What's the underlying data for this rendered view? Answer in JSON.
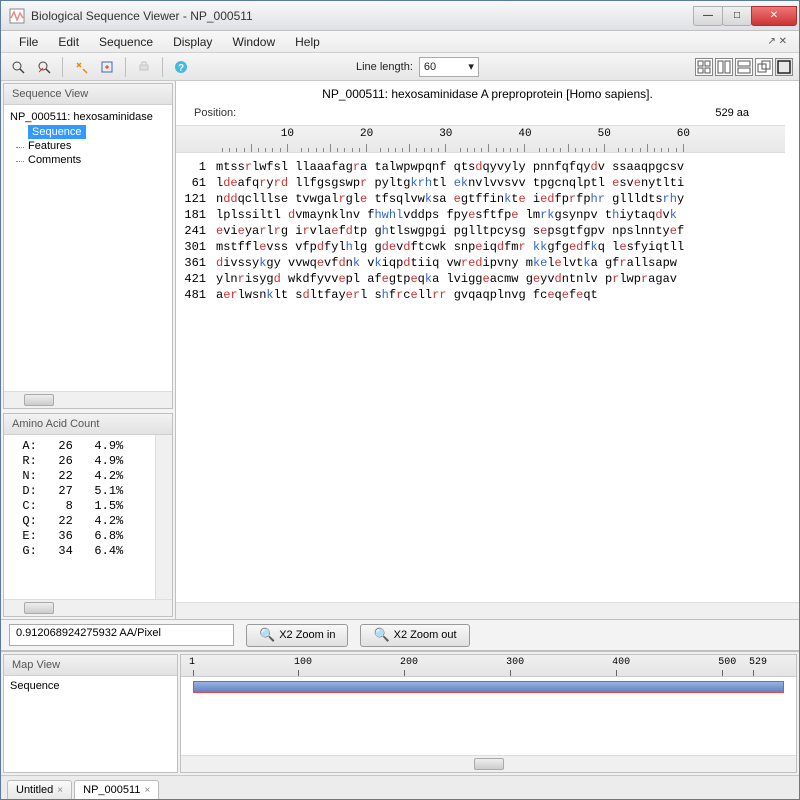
{
  "window": {
    "title": "Biological Sequence Viewer - NP_000511"
  },
  "menu": {
    "file": "File",
    "edit": "Edit",
    "sequence": "Sequence",
    "display": "Display",
    "window": "Window",
    "help": "Help"
  },
  "toolbar": {
    "line_length_label": "Line length:",
    "line_length_value": "60"
  },
  "sequence_view": {
    "panel_title": "Sequence View",
    "root": "NP_000511: hexosaminidase",
    "items": [
      "Sequence",
      "Features",
      "Comments"
    ],
    "selected_index": 0
  },
  "amino_acid_count": {
    "panel_title": "Amino Acid Count",
    "rows": [
      {
        "aa": "A:",
        "count": "26",
        "pct": "4.9%"
      },
      {
        "aa": "R:",
        "count": "26",
        "pct": "4.9%"
      },
      {
        "aa": "N:",
        "count": "22",
        "pct": "4.2%"
      },
      {
        "aa": "D:",
        "count": "27",
        "pct": "5.1%"
      },
      {
        "aa": "C:",
        "count": "8",
        "pct": "1.5%"
      },
      {
        "aa": "Q:",
        "count": "22",
        "pct": "4.2%"
      },
      {
        "aa": "E:",
        "count": "36",
        "pct": "6.8%"
      },
      {
        "aa": "G:",
        "count": "34",
        "pct": "6.4%"
      }
    ]
  },
  "sequence_panel": {
    "title": "NP_000511: hexosaminidase A preproprotein [Homo sapiens].",
    "position_label": "Position:",
    "position_value": "529 aa",
    "ruler_marks": [
      10,
      20,
      30,
      40,
      50,
      60
    ]
  },
  "sequence_lines": [
    {
      "n": "1",
      "blocks": [
        "mtss",
        "r",
        "lwfsl llaaafag",
        "r",
        "a talwpwpqnf qts",
        "d",
        "qyvyly pnnfqfqy",
        "d",
        "v ssaaqpgcsv"
      ]
    },
    {
      "n": "61",
      "blocks": [
        "l",
        "de",
        "afq",
        "r",
        "y",
        "rd",
        " llfgsgswp",
        "r",
        " pyltg",
        "krh",
        "tl ",
        "ek",
        "nvlvvsvv tpgcnqlptl ",
        "e",
        "sv",
        "e",
        "nytlti"
      ]
    },
    {
      "n": "121",
      "blocks": [
        "n",
        "dd",
        "qclllse tvwgal",
        "r",
        "gl",
        "e",
        " tfsqlvw",
        "k",
        "sa ",
        "e",
        "gtffin",
        "k",
        "t",
        "e",
        " i",
        "ed",
        "fp",
        "r",
        "fp",
        "hr",
        " gllldts",
        "rh",
        "y"
      ]
    },
    {
      "n": "181",
      "blocks": [
        "lplssiltl ",
        "d",
        "vmaynkl",
        "nv f",
        "hw",
        "hl",
        "vdd",
        "ps fpy",
        "e",
        "sftfp",
        "e",
        " lm",
        "rk",
        "gsynpv t",
        "h",
        "iytaq",
        "d",
        "v",
        "k"
      ]
    },
    {
      "n": "241",
      "blocks": [
        "e",
        "vi",
        "e",
        "ya",
        "r",
        "l",
        "r",
        "g i",
        "r",
        "vla",
        "e",
        "f",
        "d",
        "tp g",
        "h",
        "tlswgpgi pglltpcysg s",
        "e",
        "psgtfgpv npslnnty",
        "e",
        "f"
      ]
    },
    {
      "n": "301",
      "blocks": [
        "mstffl",
        "e",
        "vss vfp",
        "d",
        "fyl",
        "h",
        "lg g",
        "de",
        "v",
        "d",
        "ftcwk snp",
        "e",
        "iq",
        "d",
        "fm",
        "r",
        " ",
        "kk",
        "gfg",
        "ed",
        "f",
        "k",
        "q l",
        "e",
        "sfyiqtll"
      ]
    },
    {
      "n": "361",
      "blocks": [
        "d",
        "ivssy",
        "k",
        "gy vvwq",
        "e",
        "vf",
        "d",
        "n",
        "k",
        " v",
        "k",
        "iqp",
        "d",
        "tiiq vw",
        "red",
        "ipvny m",
        "ke",
        "l",
        "e",
        "lvt",
        "k",
        "a gf",
        "r",
        "allsapw"
      ]
    },
    {
      "n": "421",
      "blocks": [
        "yln",
        "r",
        "isyg",
        "d",
        " w",
        "kd",
        "fyvv",
        "e",
        "pl af",
        "e",
        "gtp",
        "e",
        "q",
        "k",
        "a lvigg",
        "e",
        "acmw g",
        "e",
        "yv",
        "d",
        "ntnlv p",
        "r",
        "lwp",
        "r",
        "agav"
      ]
    },
    {
      "n": "481",
      "blocks": [
        "a",
        "er",
        "lwsn",
        "k",
        "lt s",
        "d",
        "ltfay",
        "er",
        "l s",
        "h",
        "f",
        "r",
        "c",
        "e",
        "ll",
        "rr",
        " gvqaqplnvg fc",
        "e",
        "q",
        "e",
        "f",
        "e",
        "qt"
      ]
    }
  ],
  "color_map": {
    "r": "r",
    "d": "r",
    "e": "r",
    "k": "b",
    "h": "b",
    "de": "r",
    "rd": "r",
    "er": "r",
    "ed": "r",
    "red": "r",
    "rr": "r",
    "dd": "r",
    "krh": "b",
    "ek": "b",
    "hr": "b",
    "rh": "b",
    "rk": "b",
    "kk": "b",
    "ke": "b",
    "hw": "b",
    "hl": "b"
  },
  "zoom": {
    "ratio": "0.912068924275932 AA/Pixel",
    "in": "X2 Zoom in",
    "out": "X2 Zoom out"
  },
  "map_view": {
    "panel_title": "Map View",
    "track_label": "Sequence",
    "ruler": [
      "1",
      "100",
      "200",
      "300",
      "400",
      "500",
      "529"
    ]
  },
  "tabs": {
    "untitled": "Untitled",
    "np": "NP_000511"
  }
}
